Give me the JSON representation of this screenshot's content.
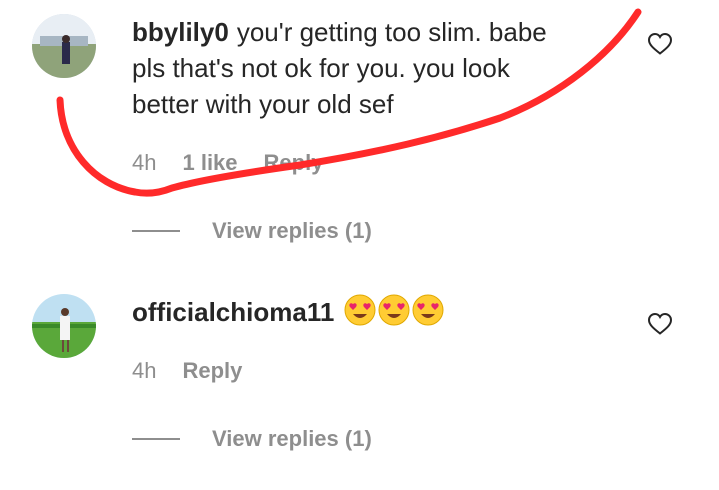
{
  "comments": [
    {
      "username": "bbylily0",
      "text_line1": "you'r getting too slim. babe",
      "text_line2": "pls that's not ok for you. you look",
      "text_line3": "better with your old sef",
      "time": "4h",
      "likes": "1 like",
      "reply_label": "Reply",
      "view_replies": "View replies (1)"
    },
    {
      "username": "officialchioma11",
      "emojis": [
        "heart-eyes-emoji",
        "heart-eyes-emoji",
        "heart-eyes-emoji"
      ],
      "time": "4h",
      "reply_label": "Reply",
      "view_replies": "View replies (1)"
    }
  ],
  "icons": {
    "like": "heart-outline-icon"
  },
  "colors": {
    "annotation_stroke": "#ff2a2a",
    "meta_text": "#8e8e8e",
    "body_text": "#262626"
  }
}
